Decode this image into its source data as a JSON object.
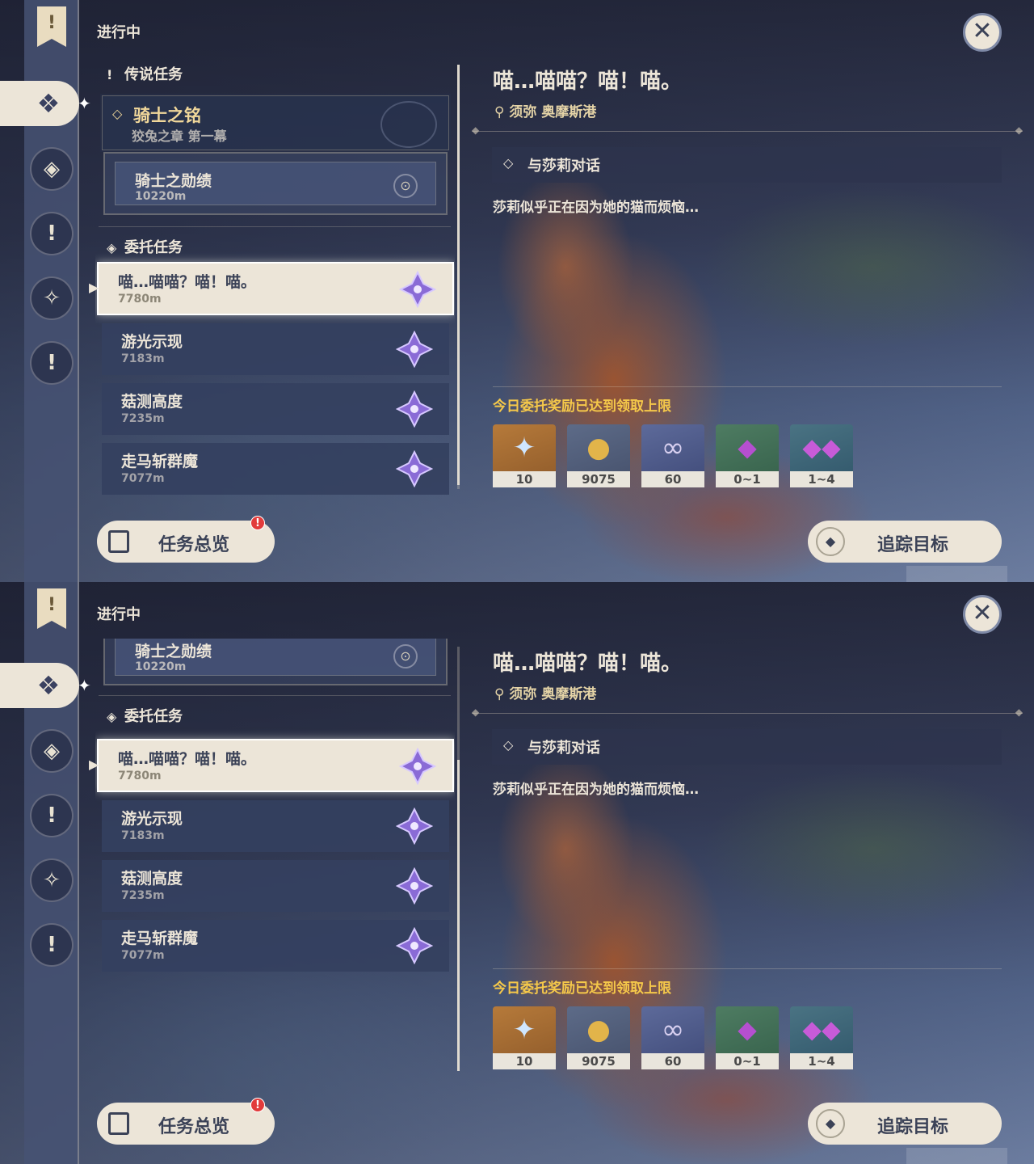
{
  "status_title": "进行中",
  "sections": {
    "legend": "传说任务",
    "commission": "委托任务"
  },
  "legend_quest": {
    "title": "骑士之铭",
    "subtitle": "狡兔之章 第一幕",
    "step_title": "骑士之勋绩",
    "step_distance": "10220m"
  },
  "commissions": [
    {
      "title": "喵…喵喵？喵！喵。",
      "distance": "7780m"
    },
    {
      "title": "游光示现",
      "distance": "7183m"
    },
    {
      "title": "菇测高度",
      "distance": "7235m"
    },
    {
      "title": "走马斩群魔",
      "distance": "7077m"
    }
  ],
  "detail": {
    "title": "喵…喵喵？喵！喵。",
    "location": "须弥 奥摩斯港",
    "objective": "与莎莉对话",
    "description": "莎莉似乎正在因为她的猫而烦恼…",
    "reward_note": "今日委托奖励已达到领取上限"
  },
  "rewards": [
    {
      "icon": "primogem-icon",
      "count": "10"
    },
    {
      "icon": "mora-icon",
      "count": "9075"
    },
    {
      "icon": "companionship-exp-icon",
      "count": "60"
    },
    {
      "icon": "crystal-ore-icon",
      "count": "0~1"
    },
    {
      "icon": "crystal-cluster-icon",
      "count": "1~4"
    }
  ],
  "buttons": {
    "overview": "任务总览",
    "overview_badge": "!",
    "track": "追踪目标"
  },
  "colors": {
    "accent_gold": "#f5c84a",
    "panel_cream": "#ece5d8",
    "list_item": "#344060",
    "badge_red": "#e23b3b"
  }
}
